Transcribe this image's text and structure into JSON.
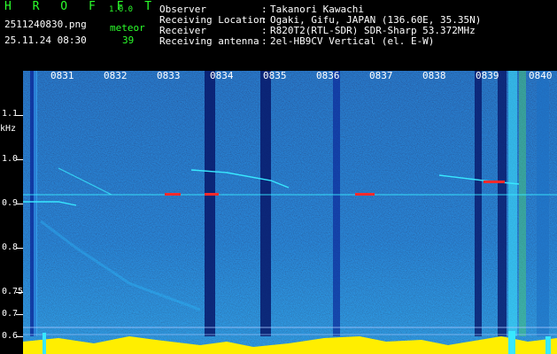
{
  "header": {
    "app_name": "H R O F F T",
    "version": "1.0.0",
    "filename": "2511240830.png",
    "datetime": "25.11.24 08:30",
    "meteor_label": "meteor",
    "meteor_count": "39",
    "info": [
      {
        "key": "Observer",
        "sep": ":",
        "value": "Takanori Kawachi"
      },
      {
        "key": "Receiving Location",
        "sep": ":",
        "value": "Ogaki, Gifu, JAPAN (136.60E, 35.35N)"
      },
      {
        "key": "Receiver",
        "sep": ":",
        "value": "R820T2(RTL-SDR) SDR-Sharp 53.372MHz"
      },
      {
        "key": "Receiving antenna",
        "sep": ":",
        "value": "2el-HB9CV Vertical (el. E-W)"
      }
    ]
  },
  "axis": {
    "unit": "kHz",
    "y_labels": [
      "1.1",
      "1.0",
      "0.9",
      "0.8",
      "0.75",
      "0.7",
      "0.6"
    ],
    "x_labels": [
      "0831",
      "0832",
      "0833",
      "0834",
      "0835",
      "0836",
      "0837",
      "0838",
      "0839",
      "0840"
    ]
  },
  "colors": {
    "background": "#0a1f8c",
    "header_green": "#2cff2c",
    "header_white": "#ffffff",
    "signal_cyan": "#38e8ff",
    "signal_yellow": "#ffee00",
    "marker_red": "#ff2a2a"
  }
}
